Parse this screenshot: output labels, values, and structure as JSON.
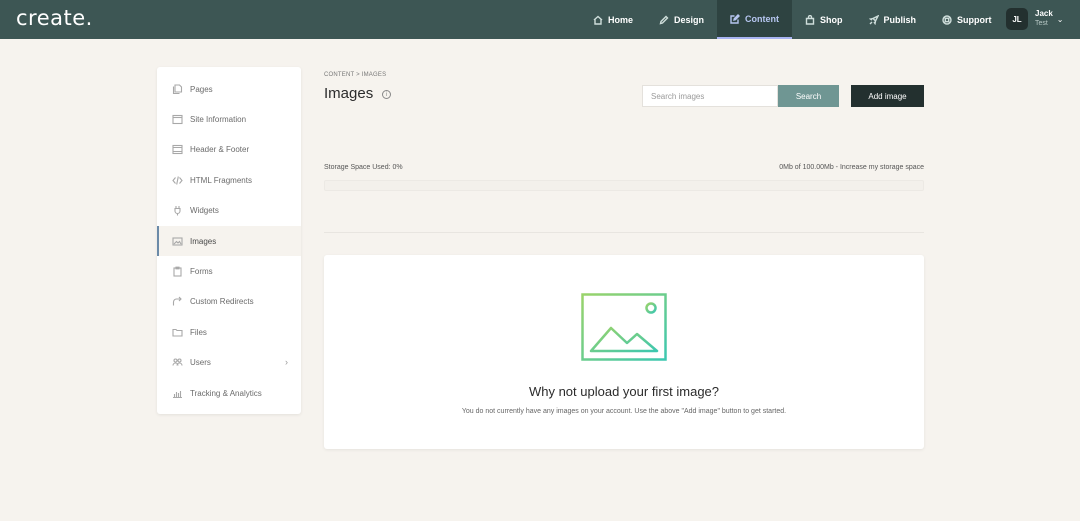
{
  "app": {
    "logo": "create."
  },
  "nav": [
    {
      "label": "Home",
      "icon": "home-icon"
    },
    {
      "label": "Design",
      "icon": "pen-icon"
    },
    {
      "label": "Content",
      "icon": "edit-icon",
      "active": true
    },
    {
      "label": "Shop",
      "icon": "bag-icon"
    },
    {
      "label": "Publish",
      "icon": "rocket-icon"
    },
    {
      "label": "Support",
      "icon": "lifebuoy-icon"
    }
  ],
  "user": {
    "initials": "JL",
    "name": "Jack",
    "subtitle": "Test",
    "caret": "⌄"
  },
  "sidebar": {
    "items": [
      {
        "label": "Pages",
        "icon": "pages-icon"
      },
      {
        "label": "Site Information",
        "icon": "window-icon"
      },
      {
        "label": "Header & Footer",
        "icon": "layout-icon"
      },
      {
        "label": "HTML Fragments",
        "icon": "code-icon"
      },
      {
        "label": "Widgets",
        "icon": "plug-icon"
      },
      {
        "label": "Images",
        "icon": "image-icon",
        "active": true
      },
      {
        "label": "Forms",
        "icon": "clipboard-icon"
      },
      {
        "label": "Custom Redirects",
        "icon": "redirect-icon"
      },
      {
        "label": "Files",
        "icon": "folder-icon"
      },
      {
        "label": "Users",
        "icon": "users-icon",
        "caret": "›"
      },
      {
        "label": "Tracking & Analytics",
        "icon": "chart-icon"
      }
    ]
  },
  "main": {
    "breadcrumb": "CONTENT > IMAGES",
    "title": "Images",
    "info_glyph": "i",
    "search": {
      "placeholder": "Search images",
      "value": "",
      "button": "Search"
    },
    "add_button": "Add image",
    "storage": {
      "label": "Storage Space Used: 0%",
      "used_fraction": 0,
      "summary": "0Mb of 100.00Mb",
      "separator": " - ",
      "link": "Increase my storage space"
    },
    "empty": {
      "title": "Why not upload your first image?",
      "description": "You do not currently have any images on your account. Use the above \"Add image\" button to get started."
    }
  },
  "colors": {
    "topbar": "#3d5654",
    "accent": "#6f9693",
    "dark": "#23302f",
    "background": "#f6f3ee",
    "active_nav": "#b6c6f0"
  }
}
